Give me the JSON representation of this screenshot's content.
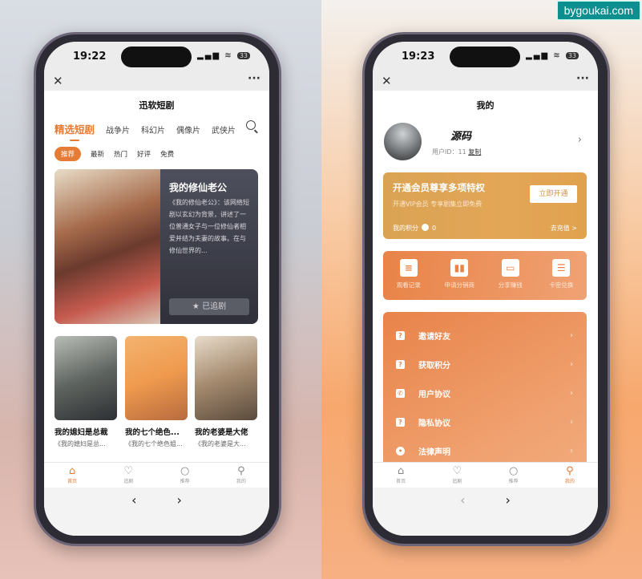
{
  "watermark": "bygoukai.com",
  "colors": {
    "accent": "#e57b35",
    "vip_gold": "#e0a24e",
    "menu_orange": "#e8834a"
  },
  "left": {
    "status": {
      "time": "19:22",
      "battery": "33"
    },
    "browser": {
      "close_icon": "close-icon",
      "more_icon": "more-icon"
    },
    "title": "迅软短剧",
    "tabs": [
      {
        "label": "精选短剧",
        "active": true
      },
      {
        "label": "战争片"
      },
      {
        "label": "科幻片"
      },
      {
        "label": "偶像片"
      },
      {
        "label": "武侠片"
      }
    ],
    "subtabs": [
      {
        "label": "推荐",
        "active": true
      },
      {
        "label": "最新"
      },
      {
        "label": "热门"
      },
      {
        "label": "好评"
      },
      {
        "label": "免费"
      }
    ],
    "featured": {
      "title": "我的修仙老公",
      "desc": "《我的修仙老公》：该网络短剧以玄幻为背景，讲述了一位普通女子与一位修仙者相爱并结为夫妻的故事。在与修仙世界的...",
      "button": "已追剧"
    },
    "cards": [
      {
        "title": "我的媳妇是总裁",
        "sub": "《我的媳妇是总..."
      },
      {
        "title": "我的七个绝色...",
        "sub": "《我的七个绝色姐..."
      },
      {
        "title": "我的老婆是大佬",
        "sub": "《我的老婆是大..."
      }
    ],
    "tabbar": [
      {
        "label": "首页",
        "icon": "home-icon",
        "active": true
      },
      {
        "label": "追剧",
        "icon": "heart-icon"
      },
      {
        "label": "推荐",
        "icon": "search-icon"
      },
      {
        "label": "我的",
        "icon": "user-icon"
      }
    ]
  },
  "right": {
    "status": {
      "time": "19:23",
      "battery": "33"
    },
    "title": "我的",
    "profile": {
      "name": "源码",
      "id_label": "用户ID：",
      "id": "11",
      "copy": "复制"
    },
    "vip": {
      "title": "开通会员尊享多项特权",
      "sub": "开通VIP会员 专享剧集立即免费",
      "button": "立即开通",
      "points_label": "我的积分",
      "points": "0",
      "recharge": "去充值 >"
    },
    "shortcuts": [
      {
        "label": "观看记录",
        "icon": "history-icon"
      },
      {
        "label": "申请分销商",
        "icon": "chart-icon"
      },
      {
        "label": "分享赚钱",
        "icon": "wallet-icon"
      },
      {
        "label": "卡密兑换",
        "icon": "clipboard-icon"
      }
    ],
    "menu": [
      {
        "label": "邀请好友",
        "icon": "help-icon"
      },
      {
        "label": "获取积分",
        "icon": "help-icon"
      },
      {
        "label": "用户协议",
        "icon": "phone-icon"
      },
      {
        "label": "隐私协议",
        "icon": "help-icon"
      },
      {
        "label": "法律声明",
        "icon": "bulb-icon"
      }
    ],
    "tabbar": [
      {
        "label": "首页",
        "icon": "home-icon"
      },
      {
        "label": "追剧",
        "icon": "heart-icon"
      },
      {
        "label": "推荐",
        "icon": "search-icon"
      },
      {
        "label": "我的",
        "icon": "user-icon",
        "active": true
      }
    ]
  }
}
